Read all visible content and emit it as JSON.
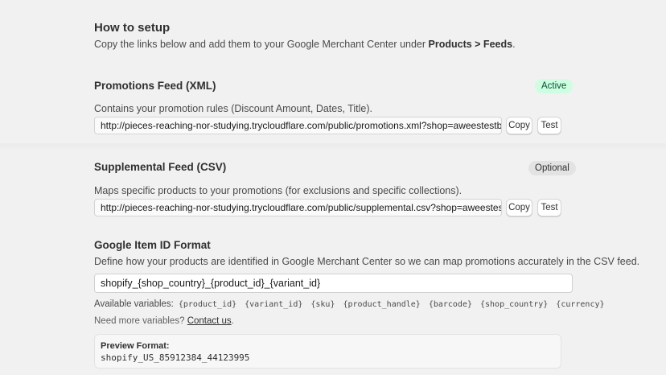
{
  "setup": {
    "title": "How to setup",
    "intro_prefix": "Copy the links below and add them to your Google Merchant Center under ",
    "intro_bold": "Products > Feeds",
    "intro_suffix": "."
  },
  "promotions_feed": {
    "title": "Promotions Feed (XML)",
    "badge": "Active",
    "description": "Contains your promotion rules (Discount Amount, Dates, Title).",
    "url": "http://pieces-reaching-nor-studying.trycloudflare.com/public/promotions.xml?shop=aweestestbasic.myshopify.com",
    "copy_label": "Copy",
    "test_label": "Test"
  },
  "supplemental_feed": {
    "title": "Supplemental Feed (CSV)",
    "badge": "Optional",
    "description": "Maps specific products to your promotions (for exclusions and specific collections).",
    "url": "http://pieces-reaching-nor-studying.trycloudflare.com/public/supplemental.csv?shop=aweestestbasic.myshopify.com",
    "copy_label": "Copy",
    "test_label": "Test"
  },
  "item_id_format": {
    "title": "Google Item ID Format",
    "description": "Define how your products are identified in Google Merchant Center so we can map promotions accurately in the CSV feed.",
    "value": "shopify_{shop_country}_{product_id}_{variant_id}",
    "variables_label": "Available variables:",
    "variables": [
      "{product_id}",
      "{variant_id}",
      "{sku}",
      "{product_handle}",
      "{barcode}",
      "{shop_country}",
      "{currency}"
    ],
    "help_prefix": "Need more variables? ",
    "help_link": "Contact us",
    "help_suffix": ".",
    "preview_label": "Preview Format:",
    "preview_value": "shopify_US_85912384_44123995"
  },
  "colors": {
    "background": "#f1f1f1",
    "active_badge_bg": "#cdfee1",
    "optional_badge_bg": "#e3e3e3"
  }
}
